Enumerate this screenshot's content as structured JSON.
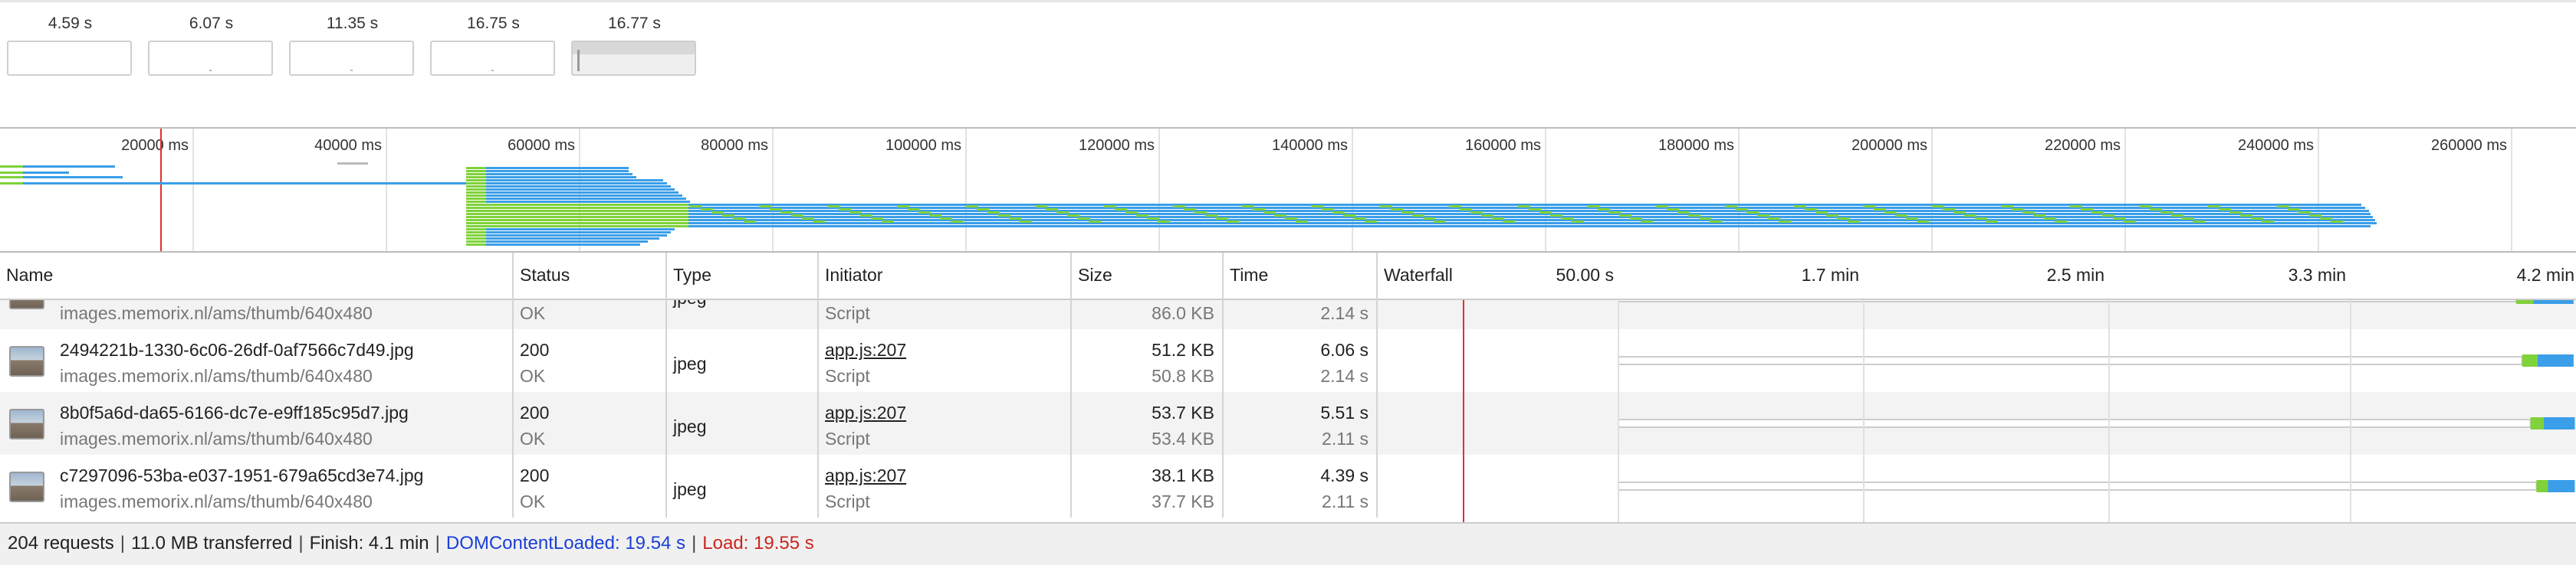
{
  "filmstrip": {
    "frames": [
      {
        "time": "4.59 s"
      },
      {
        "time": "6.07 s"
      },
      {
        "time": "11.35 s"
      },
      {
        "time": "16.75 s"
      },
      {
        "time": "16.77 s"
      }
    ]
  },
  "overview": {
    "ticks": [
      "20000 ms",
      "40000 ms",
      "60000 ms",
      "80000 ms",
      "100000 ms",
      "120000 ms",
      "140000 ms",
      "160000 ms",
      "180000 ms",
      "200000 ms",
      "220000 ms",
      "240000 ms",
      "260000 ms"
    ]
  },
  "columns": {
    "name": "Name",
    "status": "Status",
    "type": "Type",
    "initiator": "Initiator",
    "size": "Size",
    "time": "Time",
    "waterfall": "Waterfall"
  },
  "waterfall_ticks": [
    "50.00 s",
    "1.7 min",
    "2.5 min",
    "3.3 min",
    "4.2 min"
  ],
  "rows": [
    {
      "name": "",
      "domain": "images.memorix.nl/ams/thumb/640x480",
      "status": "",
      "status_text": "OK",
      "type": "jpeg",
      "initiator": "",
      "initiator_type": "Script",
      "size": "",
      "size2": "86.0 KB",
      "time": "",
      "time2": "2.14 s",
      "bar_start": 0.95,
      "bar_end": 0.998
    },
    {
      "name": "2494221b-1330-6c06-26df-0af7566c7d49.jpg",
      "domain": "images.memorix.nl/ams/thumb/640x480",
      "status": "200",
      "status_text": "OK",
      "type": "jpeg",
      "initiator": "app.js:207",
      "initiator_type": "Script",
      "size": "51.2 KB",
      "size2": "50.8 KB",
      "time": "6.06 s",
      "time2": "2.14 s",
      "bar_start": 0.955,
      "bar_end": 0.998
    },
    {
      "name": "8b0f5a6d-da65-6166-dc7e-e9ff185c95d7.jpg",
      "domain": "images.memorix.nl/ams/thumb/640x480",
      "status": "200",
      "status_text": "OK",
      "type": "jpeg",
      "initiator": "app.js:207",
      "initiator_type": "Script",
      "size": "53.7 KB",
      "size2": "53.4 KB",
      "time": "5.51 s",
      "time2": "2.11 s",
      "bar_start": 0.962,
      "bar_end": 0.999
    },
    {
      "name": "c7297096-53ba-e037-1951-679a65cd3e74.jpg",
      "domain": "images.memorix.nl/ams/thumb/640x480",
      "status": "200",
      "status_text": "OK",
      "type": "jpeg",
      "initiator": "app.js:207",
      "initiator_type": "Script",
      "size": "38.1 KB",
      "size2": "37.7 KB",
      "time": "4.39 s",
      "time2": "2.11 s",
      "bar_start": 0.967,
      "bar_end": 0.999
    }
  ],
  "status_bar": {
    "requests": "204 requests",
    "transferred": "11.0 MB transferred",
    "finish": "Finish: 4.1 min",
    "dcl": "DOMContentLoaded: 19.54 s",
    "load": "Load: 19.55 s"
  },
  "colors": {
    "waiting": "#7fd23a",
    "receiving": "#3a9ee8",
    "load_line": "#e03030",
    "dcl_line": "#1a3fd6"
  }
}
